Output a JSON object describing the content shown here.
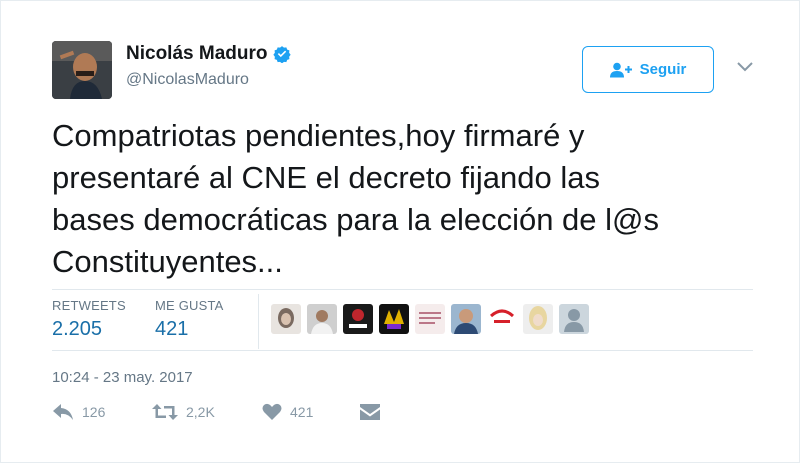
{
  "author": {
    "name": "Nicolás Maduro",
    "handle": "@NicolasMaduro",
    "verified": true
  },
  "follow_button": {
    "label": "Seguir",
    "icon": "add-user-icon"
  },
  "tweet": {
    "text": "Compatriotas pendientes,hoy firmaré y\npresentaré al CNE el decreto fijando las\nbases democráticas para la elección de l@s\nConstituyentes..."
  },
  "stats": {
    "retweets": {
      "label": "RETWEETS",
      "value": "2.205"
    },
    "likes": {
      "label": "ME GUSTA",
      "value": "421"
    }
  },
  "likers_count_shown": 9,
  "timestamp": "10:24 - 23 may. 2017",
  "actions": {
    "reply": {
      "icon": "reply-icon",
      "count": "126"
    },
    "retweet": {
      "icon": "retweet-icon",
      "count": "2,2K"
    },
    "like": {
      "icon": "heart-icon",
      "count": "421"
    },
    "message": {
      "icon": "envelope-icon"
    }
  },
  "colors": {
    "accent": "#1da1f2",
    "stat_value": "#1a6fa8",
    "muted": "#657786",
    "icon_muted": "#8899a6"
  }
}
